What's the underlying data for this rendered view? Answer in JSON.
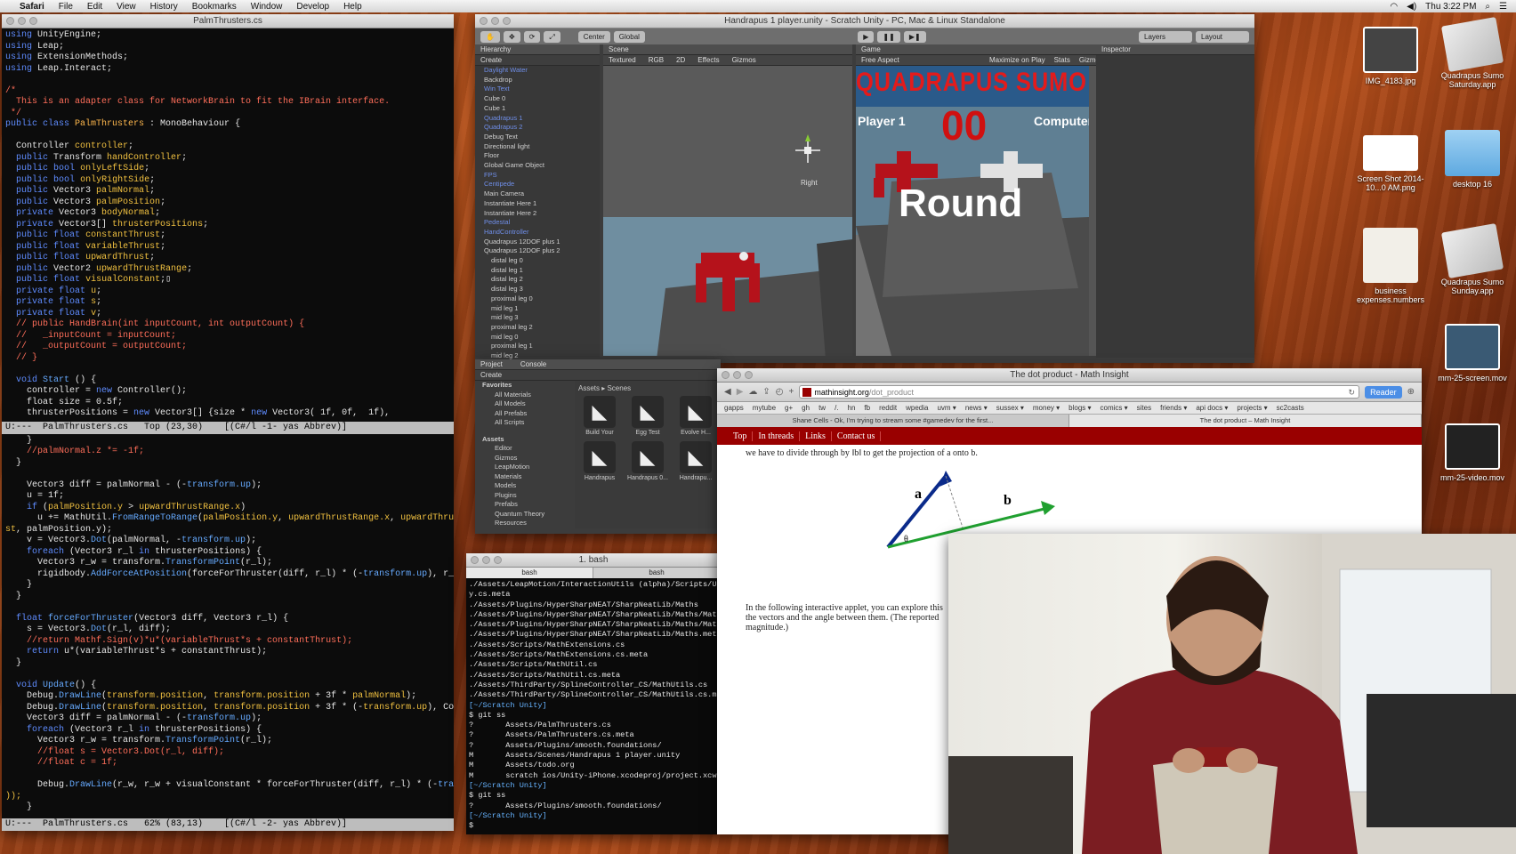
{
  "menubar": {
    "apple": "",
    "app": "Safari",
    "items": [
      "File",
      "Edit",
      "View",
      "History",
      "Bookmarks",
      "Window",
      "Develop",
      "Help"
    ],
    "clock": "Thu 3:22 PM"
  },
  "emacs": {
    "title": "PalmThrusters.cs",
    "modeline_top": "U:---  PalmThrusters.cs   Top (23,30)    [(C#/l -1- yas Abbrev)]",
    "modeline_bottom": "U:---  PalmThrusters.cs   62% (83,13)    [(C#/l -2- yas Abbrev)]"
  },
  "unity": {
    "title": "Handrapus 1 player.unity - Scratch Unity - PC, Mac & Linux Standalone",
    "toolbar": {
      "center": "Center",
      "global": "Global",
      "layers": "Layers",
      "layout": "Layout"
    },
    "tabs": {
      "hierarchy": "Hierarchy",
      "scene": "Scene",
      "game": "Game",
      "inspector": "Inspector",
      "project": "Project",
      "console": "Console"
    },
    "scene_opts": {
      "textured": "Textured",
      "rgb": "RGB",
      "mode2d": "2D",
      "effects": "Effects",
      "gizmos": "Gizmos",
      "right": "Right"
    },
    "game_opts": {
      "aspect": "Free Aspect",
      "maximize": "Maximize on Play",
      "stats": "Stats",
      "gizmos": "Gizmos"
    },
    "create": "Create",
    "hierarchy": [
      "Daylight Water",
      "Backdrop",
      "Win Text",
      "Cube 0",
      "Cube 1",
      "Quadrapus 1",
      "Quadrapus 2",
      "Debug Text",
      "Directional light",
      "Floor",
      "Global Game Object",
      "FPS",
      "Centipede",
      "Main Camera",
      "Instantiate Here 1",
      "Instantiate Here 2",
      "Pedestal",
      "HandController",
      "Quadrapus 12DOF plus 1",
      "Quadrapus 12DOF plus 2",
      "distal leg 0",
      "distal leg 1",
      "distal leg 2",
      "distal leg 3",
      "proximal leg 0",
      "mid leg 1",
      "mid leg 3",
      "proximal leg 2",
      "mid leg 0",
      "proximal leg 1",
      "mid leg 2"
    ],
    "game": {
      "banner": "QUADRAPUS SUMO",
      "player": "Player 1",
      "score": "00",
      "computer": "Computer",
      "round": "Round"
    },
    "project": {
      "favorites": "Favorites",
      "fav": [
        "All Materials",
        "All Models",
        "All Prefabs",
        "All Scripts"
      ],
      "assets": "Assets",
      "folders": [
        "Editor",
        "Gizmos",
        "LeapMotion",
        "Materials",
        "Models",
        "Plugins",
        "Prefabs",
        "Quantum Theory",
        "Resources"
      ],
      "breadcrumb": "Assets ▸ Scenes",
      "files": [
        "Build Your",
        "Egg Test",
        "Evolve H...",
        "Handrapus",
        "Handrapus 0...",
        "Handrapu..."
      ]
    }
  },
  "terminal": {
    "title": "1. bash",
    "tabs": [
      "bash",
      "bash"
    ],
    "lines": [
      "./Assets/LeapMotion/InteractionUtils (alpha)/Scripts/UnityIn",
      "y.cs.meta",
      "./Assets/Plugins/HyperSharpNEAT/SharpNeatLib/Maths",
      "./Assets/Plugins/HyperSharpNEAT/SharpNeatLib/Maths/MathsExce",
      "./Assets/Plugins/HyperSharpNEAT/SharpNeatLib/Maths/MathsExce",
      "./Assets/Plugins/HyperSharpNEAT/SharpNeatLib/Maths.meta",
      "./Assets/Scripts/MathExtensions.cs",
      "./Assets/Scripts/MathExtensions.cs.meta",
      "./Assets/Scripts/MathUtil.cs",
      "./Assets/Scripts/MathUtil.cs.meta",
      "./Assets/ThirdParty/SplineController_CS/MathUtils.cs",
      "./Assets/ThirdParty/SplineController_CS/MathUtils.cs.meta",
      "[~/Scratch Unity]",
      "$ git ss",
      "?       Assets/PalmThrusters.cs",
      "?       Assets/PalmThrusters.cs.meta",
      "?       Assets/Plugins/smooth.foundations/",
      "M       Assets/Scenes/Handrapus 1 player.unity",
      "M       Assets/todo.org",
      "M       scratch ios/Unity-iPhone.xcodeproj/project.xcworkspa",
      "[~/Scratch Unity]",
      "$ git ss",
      "?       Assets/Plugins/smooth.foundations/",
      "[~/Scratch Unity]",
      "$ "
    ]
  },
  "browser": {
    "title": "The dot product - Math Insight",
    "url_host": "mathinsight.org",
    "url_path": "/dot_product",
    "reader": "Reader",
    "bookmarks": [
      "gapps",
      "mytube",
      "g+",
      "gh",
      "tw",
      "/.",
      "hn",
      "fb",
      "reddit",
      "wpedia",
      "uvm ▾",
      "news ▾",
      "sussex ▾",
      "money ▾",
      "blogs ▾",
      "comics ▾",
      "sites",
      "friends ▾",
      "api docs ▾",
      "projects ▾",
      "sc2casts"
    ],
    "tabs": [
      "Shane Cells - Ok, I'm trying to stream some #gamedev for the first...",
      "The dot product – Math Insight"
    ],
    "nav": [
      "Top",
      "In threads",
      "Links",
      "Contact us"
    ],
    "para1": "we have to divide through by ‖b‖ to get the projection of a onto b.",
    "label_a": "a",
    "label_b": "b",
    "label_theta": "θ",
    "para2": "In the following interactive applet, you can explore this",
    "para3": "the vectors and the angle between them. (The reported",
    "para4": "magnitude.)"
  },
  "desktop": [
    {
      "label": "IMG_4183.jpg"
    },
    {
      "label": "Quadrapus Sumo Saturday.app"
    },
    {
      "label": "Screen Shot 2014-10...0 AM.png"
    },
    {
      "label": "desktop 16"
    },
    {
      "label": "business expenses.numbers"
    },
    {
      "label": "Quadrapus Sumo Sunday.app"
    },
    {
      "label": "mm-25-screen.mov"
    },
    {
      "label": "mm-25-video.mov"
    }
  ]
}
